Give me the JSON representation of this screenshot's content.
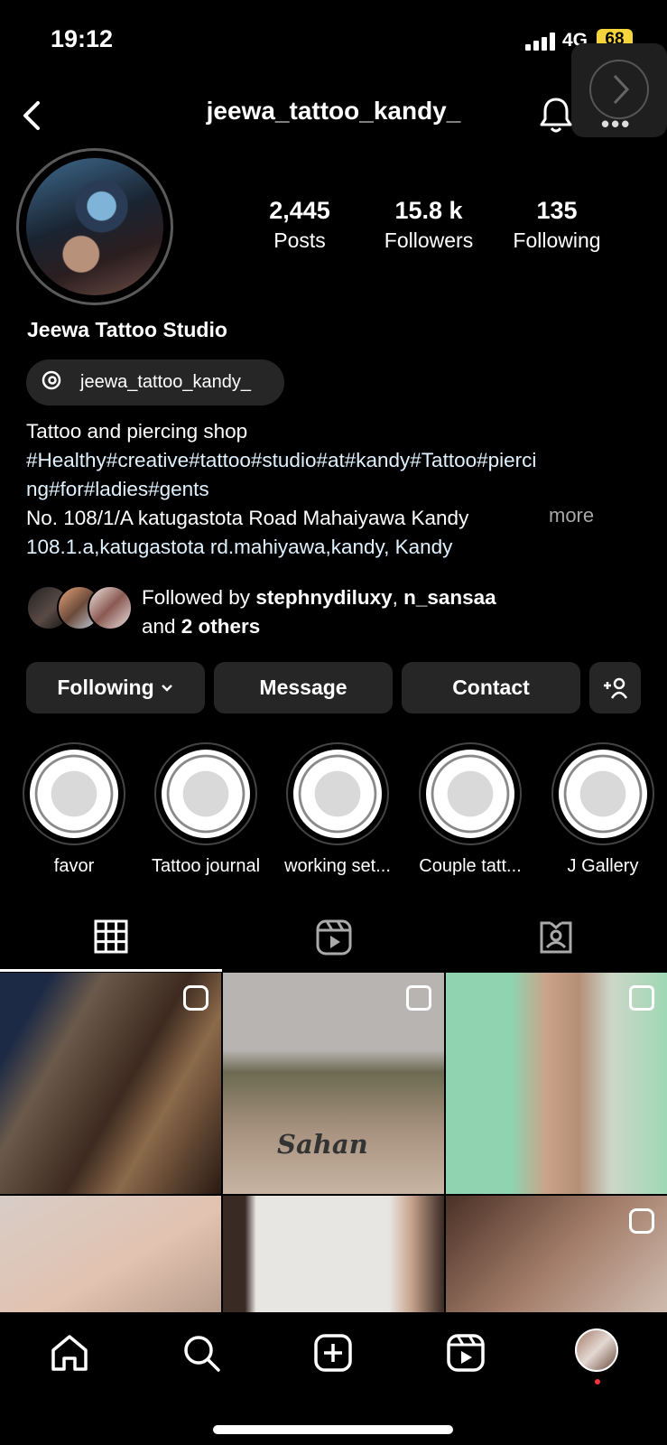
{
  "status_bar": {
    "time": "19:12",
    "network": "4G",
    "battery": "68"
  },
  "header": {
    "username": "jeewa_tattoo_kandy_",
    "icons": [
      "back-arrow-icon",
      "bell-icon",
      "more-icon"
    ]
  },
  "profile": {
    "display_name": "Jeewa Tattoo Studio",
    "stats": [
      {
        "value": "2,445",
        "label": "Posts"
      },
      {
        "value": "15.8 k",
        "label": "Followers"
      },
      {
        "value": "135",
        "label": "Following"
      }
    ],
    "threads_handle": "jeewa_tattoo_kandy_",
    "bio": {
      "line1": "Tattoo and piercing shop",
      "tags_line1": "#Healthy#creative#tattoo#studio#at#kandy#Tattoo#pierci",
      "tags_line2": "ng#for#ladies#gents",
      "address": "No. 108/1/A katugastota Road Mahaiyawa Kandy",
      "more": "more",
      "location_link": "108.1.a,katugastota rd.mahiyawa,kandy, Kandy"
    },
    "followed_by": {
      "prefix": "Followed by ",
      "user1": "stephnydiluxy",
      "separator": ", ",
      "user2": "n_sansaa",
      "and_text": "and ",
      "others": "2 others"
    }
  },
  "actions": {
    "following": "Following",
    "message": "Message",
    "contact": "Contact"
  },
  "highlights": [
    {
      "label": "favor"
    },
    {
      "label": "Tattoo journal"
    },
    {
      "label": "working set..."
    },
    {
      "label": "Couple tatt..."
    },
    {
      "label": "J Gallery"
    }
  ],
  "tabs": [
    "grid-icon",
    "reels-icon",
    "tagged-icon"
  ],
  "grid": {
    "post2_text": "Sahan"
  },
  "bottom_nav": [
    "home-icon",
    "search-icon",
    "create-icon",
    "reels-icon",
    "profile-avatar"
  ],
  "colors": {
    "background": "#000000",
    "button": "#262626",
    "link": "#e0f1ff",
    "muted": "#a8a8a8",
    "battery": "#f5d33a"
  }
}
